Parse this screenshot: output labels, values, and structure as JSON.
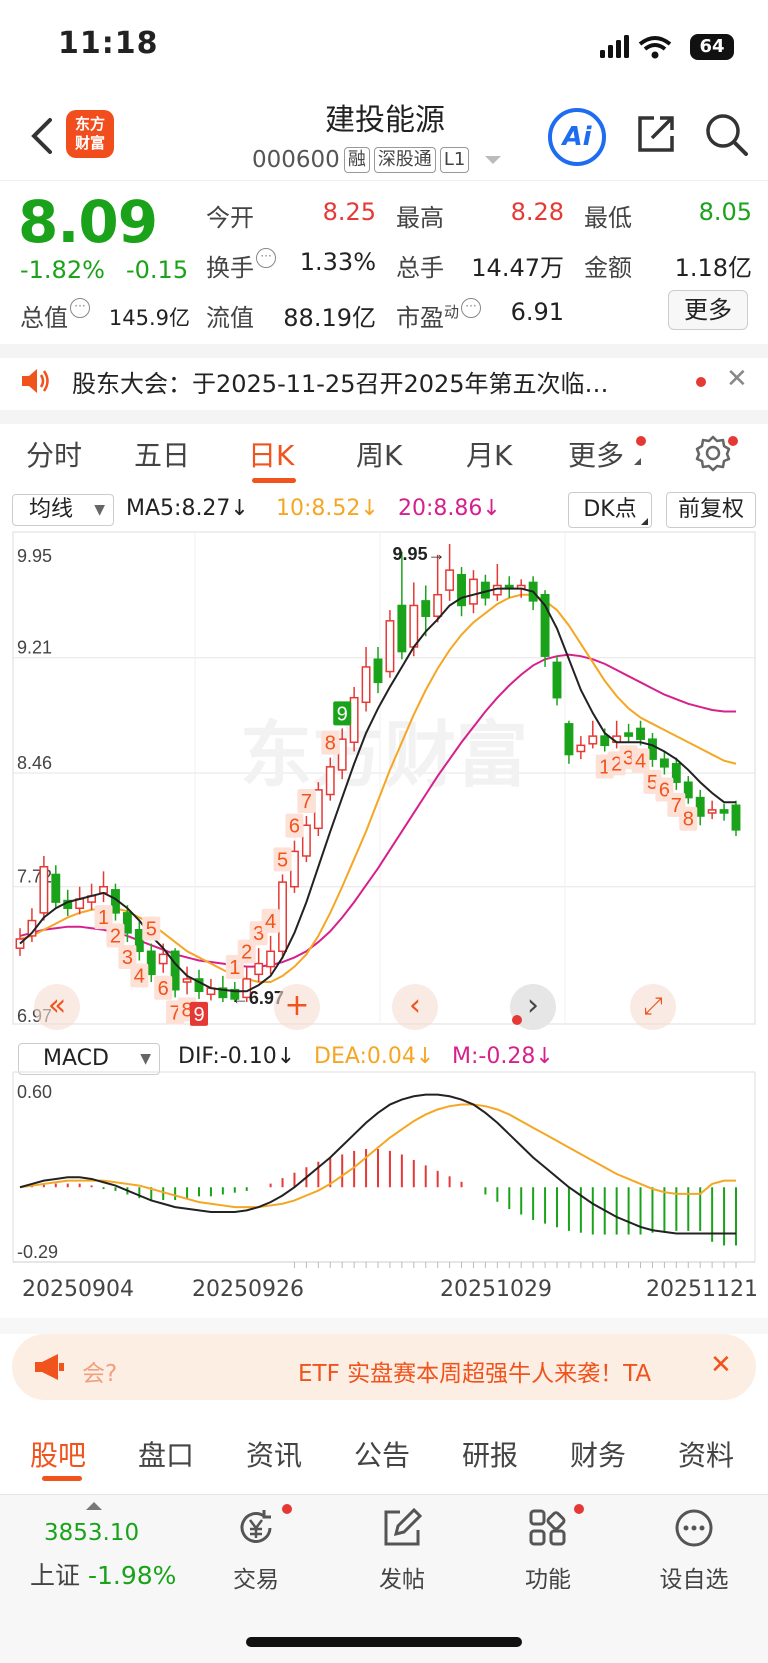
{
  "status": {
    "time": "11:18",
    "battery": "64"
  },
  "header": {
    "logo": "东方财富",
    "name": "建投能源",
    "code": "000600",
    "tags": [
      "融",
      "深股通",
      "L1"
    ],
    "ai": "Ai"
  },
  "quote": {
    "price": "8.09",
    "pct": "-1.82%",
    "change": "-0.15",
    "open_label": "今开",
    "open": "8.25",
    "high_label": "最高",
    "high": "8.28",
    "low_label": "最低",
    "low": "8.05",
    "turnover_label": "换手",
    "turnover": "1.33%",
    "volume_label": "总手",
    "volume": "14.47万",
    "amount_label": "金额",
    "amount": "1.18亿",
    "mcap_label": "总值",
    "mcap": "145.9亿",
    "float_label": "流值",
    "float": "88.19亿",
    "pe_label": "市盈",
    "pe_sup": "动",
    "pe": "6.91",
    "more": "更多"
  },
  "notice": {
    "text": "股东大会：于2025-11-25召开2025年第五次临…"
  },
  "period_tabs": [
    "分时",
    "五日",
    "日K",
    "周K",
    "月K",
    "更多"
  ],
  "ma_bar": {
    "select": "均线",
    "ma5": "MA5:8.27↓",
    "ma10": "10:8.52↓",
    "ma20": "20:8.86↓",
    "dk": "DK点",
    "adjust": "前复权"
  },
  "colors": {
    "up": "#e53935",
    "down": "#1aa31a",
    "accent": "#f0531c",
    "ma5": "#222222",
    "ma10": "#f5a623",
    "ma20": "#d6208c"
  },
  "chart_data": [
    {
      "type": "candlestick",
      "title": "日K",
      "y_ticks": [
        "9.95",
        "9.21",
        "8.46",
        "7.72",
        "6.97"
      ],
      "ylim": [
        6.97,
        9.95
      ],
      "annotations": {
        "high": "9.95",
        "low": "6.97"
      },
      "candles": [
        {
          "o": 7.32,
          "c": 7.38,
          "h": 7.45,
          "l": 7.27
        },
        {
          "o": 7.4,
          "c": 7.5,
          "h": 7.58,
          "l": 7.36
        },
        {
          "o": 7.55,
          "c": 7.85,
          "h": 7.92,
          "l": 7.5
        },
        {
          "o": 7.8,
          "c": 7.62,
          "h": 7.86,
          "l": 7.58
        },
        {
          "o": 7.63,
          "c": 7.58,
          "h": 7.7,
          "l": 7.53
        },
        {
          "o": 7.58,
          "c": 7.64,
          "h": 7.72,
          "l": 7.54
        },
        {
          "o": 7.62,
          "c": 7.66,
          "h": 7.74,
          "l": 7.57
        },
        {
          "o": 7.68,
          "c": 7.72,
          "h": 7.82,
          "l": 7.62
        },
        {
          "o": 7.7,
          "c": 7.55,
          "h": 7.74,
          "l": 7.5
        },
        {
          "o": 7.55,
          "c": 7.42,
          "h": 7.6,
          "l": 7.36
        },
        {
          "o": 7.44,
          "c": 7.3,
          "h": 7.5,
          "l": 7.24
        },
        {
          "o": 7.3,
          "c": 7.15,
          "h": 7.35,
          "l": 7.1
        },
        {
          "o": 7.22,
          "c": 7.28,
          "h": 7.35,
          "l": 7.16
        },
        {
          "o": 7.3,
          "c": 7.05,
          "h": 7.32,
          "l": 7.0
        },
        {
          "o": 7.1,
          "c": 7.12,
          "h": 7.2,
          "l": 7.02
        },
        {
          "o": 7.12,
          "c": 7.04,
          "h": 7.18,
          "l": 6.99
        },
        {
          "o": 7.02,
          "c": 7.06,
          "h": 7.12,
          "l": 6.98
        },
        {
          "o": 7.06,
          "c": 7.0,
          "h": 7.14,
          "l": 6.97
        },
        {
          "o": 7.05,
          "c": 6.99,
          "h": 7.1,
          "l": 6.97
        },
        {
          "o": 7.0,
          "c": 7.12,
          "h": 7.2,
          "l": 6.97
        },
        {
          "o": 7.15,
          "c": 7.22,
          "h": 7.32,
          "l": 7.1
        },
        {
          "o": 7.2,
          "c": 7.3,
          "h": 7.4,
          "l": 7.15
        },
        {
          "o": 7.3,
          "c": 7.75,
          "h": 7.8,
          "l": 7.25
        },
        {
          "o": 7.72,
          "c": 7.95,
          "h": 8.02,
          "l": 7.68
        },
        {
          "o": 7.92,
          "c": 8.12,
          "h": 8.18,
          "l": 7.88
        },
        {
          "o": 8.1,
          "c": 8.35,
          "h": 8.4,
          "l": 8.05
        },
        {
          "o": 8.32,
          "c": 8.5,
          "h": 8.56,
          "l": 8.28
        },
        {
          "o": 8.48,
          "c": 8.68,
          "h": 8.75,
          "l": 8.42
        },
        {
          "o": 8.66,
          "c": 8.95,
          "h": 9.02,
          "l": 8.6
        },
        {
          "o": 8.92,
          "c": 9.15,
          "h": 9.28,
          "l": 8.86
        },
        {
          "o": 9.2,
          "c": 9.05,
          "h": 9.28,
          "l": 8.98
        },
        {
          "o": 9.12,
          "c": 9.45,
          "h": 9.52,
          "l": 9.08
        },
        {
          "o": 9.55,
          "c": 9.25,
          "h": 9.9,
          "l": 9.2
        },
        {
          "o": 9.28,
          "c": 9.55,
          "h": 9.7,
          "l": 9.22
        },
        {
          "o": 9.58,
          "c": 9.48,
          "h": 9.68,
          "l": 9.35
        },
        {
          "o": 9.48,
          "c": 9.62,
          "h": 9.88,
          "l": 9.44
        },
        {
          "o": 9.65,
          "c": 9.78,
          "h": 9.95,
          "l": 9.58
        },
        {
          "o": 9.75,
          "c": 9.55,
          "h": 9.8,
          "l": 9.48
        },
        {
          "o": 9.56,
          "c": 9.72,
          "h": 9.78,
          "l": 9.5
        },
        {
          "o": 9.7,
          "c": 9.6,
          "h": 9.75,
          "l": 9.55
        },
        {
          "o": 9.62,
          "c": 9.68,
          "h": 9.82,
          "l": 9.58
        },
        {
          "o": 9.68,
          "c": 9.66,
          "h": 9.74,
          "l": 9.6
        },
        {
          "o": 9.66,
          "c": 9.68,
          "h": 9.72,
          "l": 9.6
        },
        {
          "o": 9.7,
          "c": 9.58,
          "h": 9.74,
          "l": 9.52
        },
        {
          "o": 9.62,
          "c": 9.22,
          "h": 9.65,
          "l": 9.15
        },
        {
          "o": 9.18,
          "c": 8.95,
          "h": 9.22,
          "l": 8.9
        },
        {
          "o": 8.78,
          "c": 8.58,
          "h": 8.8,
          "l": 8.52
        },
        {
          "o": 8.6,
          "c": 8.64,
          "h": 8.7,
          "l": 8.55
        },
        {
          "o": 8.65,
          "c": 8.7,
          "h": 8.8,
          "l": 8.62
        },
        {
          "o": 8.7,
          "c": 8.64,
          "h": 8.75,
          "l": 8.6
        },
        {
          "o": 8.66,
          "c": 8.7,
          "h": 8.8,
          "l": 8.62
        },
        {
          "o": 8.72,
          "c": 8.7,
          "h": 8.78,
          "l": 8.66
        },
        {
          "o": 8.75,
          "c": 8.68,
          "h": 8.8,
          "l": 8.64
        },
        {
          "o": 8.68,
          "c": 8.55,
          "h": 8.72,
          "l": 8.5
        },
        {
          "o": 8.55,
          "c": 8.5,
          "h": 8.6,
          "l": 8.45
        },
        {
          "o": 8.52,
          "c": 8.4,
          "h": 8.56,
          "l": 8.35
        },
        {
          "o": 8.4,
          "c": 8.3,
          "h": 8.44,
          "l": 8.26
        },
        {
          "o": 8.3,
          "c": 8.18,
          "h": 8.35,
          "l": 8.12
        },
        {
          "o": 8.2,
          "c": 8.22,
          "h": 8.28,
          "l": 8.16
        },
        {
          "o": 8.22,
          "c": 8.2,
          "h": 8.26,
          "l": 8.15
        },
        {
          "o": 8.25,
          "c": 8.09,
          "h": 8.28,
          "l": 8.05
        }
      ],
      "ma5": [
        7.35,
        7.42,
        7.52,
        7.58,
        7.62,
        7.64,
        7.66,
        7.68,
        7.64,
        7.58,
        7.5,
        7.4,
        7.32,
        7.22,
        7.14,
        7.1,
        7.06,
        7.05,
        7.04,
        7.04,
        7.08,
        7.14,
        7.26,
        7.42,
        7.62,
        7.85,
        8.08,
        8.3,
        8.52,
        8.72,
        8.88,
        9.02,
        9.15,
        9.28,
        9.38,
        9.46,
        9.55,
        9.6,
        9.62,
        9.64,
        9.66,
        9.66,
        9.66,
        9.64,
        9.55,
        9.4,
        9.2,
        9.0,
        8.85,
        8.72,
        8.66,
        8.66,
        8.66,
        8.64,
        8.6,
        8.55,
        8.48,
        8.4,
        8.33,
        8.27,
        8.27
      ],
      "ma10": [
        7.38,
        7.4,
        7.44,
        7.48,
        7.52,
        7.55,
        7.57,
        7.58,
        7.58,
        7.56,
        7.52,
        7.48,
        7.42,
        7.36,
        7.3,
        7.26,
        7.22,
        7.18,
        7.14,
        7.12,
        7.1,
        7.1,
        7.14,
        7.2,
        7.28,
        7.4,
        7.55,
        7.72,
        7.9,
        8.08,
        8.28,
        8.48,
        8.66,
        8.84,
        9.0,
        9.14,
        9.26,
        9.36,
        9.44,
        9.5,
        9.56,
        9.6,
        9.62,
        9.62,
        9.58,
        9.52,
        9.42,
        9.3,
        9.18,
        9.06,
        8.96,
        8.88,
        8.82,
        8.78,
        8.74,
        8.7,
        8.66,
        8.62,
        8.58,
        8.54,
        8.52
      ],
      "ma20": [
        7.4,
        7.42,
        7.44,
        7.45,
        7.46,
        7.46,
        7.45,
        7.44,
        7.42,
        7.4,
        7.37,
        7.34,
        7.31,
        7.28,
        7.26,
        7.24,
        7.23,
        7.22,
        7.21,
        7.2,
        7.2,
        7.21,
        7.23,
        7.26,
        7.3,
        7.36,
        7.43,
        7.52,
        7.62,
        7.73,
        7.84,
        7.96,
        8.08,
        8.2,
        8.32,
        8.44,
        8.55,
        8.66,
        8.76,
        8.86,
        8.95,
        9.03,
        9.1,
        9.16,
        9.2,
        9.22,
        9.23,
        9.22,
        9.2,
        9.17,
        9.13,
        9.09,
        9.05,
        9.01,
        8.97,
        8.94,
        8.91,
        8.89,
        8.87,
        8.86,
        8.86
      ],
      "signals": [
        {
          "i": 7,
          "t": "1",
          "pos": "below"
        },
        {
          "i": 8,
          "t": "2",
          "pos": "below"
        },
        {
          "i": 9,
          "t": "3",
          "pos": "below"
        },
        {
          "i": 10,
          "t": "4",
          "pos": "below"
        },
        {
          "i": 11,
          "t": "5",
          "pos": "above"
        },
        {
          "i": 12,
          "t": "6",
          "pos": "below"
        },
        {
          "i": 13,
          "t": "7",
          "pos": "below"
        },
        {
          "i": 14,
          "t": "8",
          "pos": "below"
        },
        {
          "i": 15,
          "t": "9",
          "pos": "below",
          "boxed": true
        },
        {
          "i": 18,
          "t": "1",
          "pos": "above"
        },
        {
          "i": 19,
          "t": "2",
          "pos": "above"
        },
        {
          "i": 20,
          "t": "3",
          "pos": "above"
        },
        {
          "i": 21,
          "t": "4",
          "pos": "above"
        },
        {
          "i": 22,
          "t": "5",
          "pos": "above"
        },
        {
          "i": 23,
          "t": "6",
          "pos": "above"
        },
        {
          "i": 24,
          "t": "7",
          "pos": "above"
        },
        {
          "i": 26,
          "t": "8",
          "pos": "above"
        },
        {
          "i": 27,
          "t": "9",
          "pos": "above",
          "boxed": true,
          "green": true
        },
        {
          "i": 49,
          "t": "1",
          "pos": "below"
        },
        {
          "i": 50,
          "t": "2",
          "pos": "below"
        },
        {
          "i": 51,
          "t": "3",
          "pos": "below"
        },
        {
          "i": 52,
          "t": "4",
          "pos": "below"
        },
        {
          "i": 53,
          "t": "5",
          "pos": "below"
        },
        {
          "i": 54,
          "t": "6",
          "pos": "below"
        },
        {
          "i": 55,
          "t": "7",
          "pos": "below"
        },
        {
          "i": 56,
          "t": "8",
          "pos": "below"
        }
      ]
    },
    {
      "type": "macd",
      "y_ticks": [
        "0.60",
        "-0.29"
      ],
      "ylim": [
        -0.29,
        0.6
      ],
      "x_ticks": [
        "20250904",
        "20250926",
        "20251029",
        "20251121"
      ],
      "dif": [
        0.0,
        0.02,
        0.04,
        0.05,
        0.06,
        0.06,
        0.05,
        0.03,
        0.01,
        -0.02,
        -0.05,
        -0.08,
        -0.1,
        -0.12,
        -0.13,
        -0.14,
        -0.15,
        -0.15,
        -0.15,
        -0.14,
        -0.12,
        -0.09,
        -0.05,
        0.0,
        0.06,
        0.12,
        0.18,
        0.25,
        0.32,
        0.39,
        0.45,
        0.5,
        0.53,
        0.55,
        0.56,
        0.56,
        0.55,
        0.53,
        0.5,
        0.45,
        0.39,
        0.32,
        0.25,
        0.18,
        0.12,
        0.06,
        0.0,
        -0.05,
        -0.1,
        -0.14,
        -0.18,
        -0.21,
        -0.24,
        -0.26,
        -0.27,
        -0.28,
        -0.28,
        -0.28,
        -0.28,
        -0.28,
        -0.28
      ],
      "dea": [
        0.0,
        0.01,
        0.02,
        0.03,
        0.04,
        0.04,
        0.04,
        0.04,
        0.03,
        0.02,
        0.01,
        -0.01,
        -0.03,
        -0.05,
        -0.07,
        -0.09,
        -0.1,
        -0.11,
        -0.12,
        -0.12,
        -0.12,
        -0.11,
        -0.1,
        -0.08,
        -0.05,
        -0.02,
        0.02,
        0.07,
        0.12,
        0.18,
        0.24,
        0.3,
        0.35,
        0.4,
        0.44,
        0.47,
        0.49,
        0.5,
        0.5,
        0.49,
        0.47,
        0.44,
        0.4,
        0.36,
        0.32,
        0.28,
        0.24,
        0.2,
        0.16,
        0.12,
        0.08,
        0.05,
        0.02,
        -0.01,
        -0.03,
        -0.04,
        -0.04,
        -0.04,
        0.02,
        0.04,
        0.04
      ],
      "m": [
        0.0,
        0.02,
        0.04,
        0.04,
        0.04,
        0.04,
        0.02,
        -0.02,
        -0.04,
        -0.08,
        -0.12,
        -0.14,
        -0.14,
        -0.14,
        -0.12,
        -0.1,
        -0.1,
        -0.08,
        -0.06,
        -0.04,
        0.0,
        0.04,
        0.1,
        0.16,
        0.22,
        0.28,
        0.32,
        0.36,
        0.4,
        0.42,
        0.42,
        0.4,
        0.36,
        0.3,
        0.24,
        0.18,
        0.12,
        0.06,
        0.0,
        -0.08,
        -0.16,
        -0.24,
        -0.3,
        -0.36,
        -0.4,
        -0.44,
        -0.48,
        -0.5,
        -0.52,
        -0.52,
        -0.52,
        -0.52,
        -0.52,
        -0.5,
        -0.48,
        -0.48,
        -0.48,
        -0.48,
        -0.6,
        -0.64,
        -0.64
      ]
    }
  ],
  "macd_bar": {
    "select": "MACD",
    "dif": "DIF:-0.10↓",
    "dea": "DEA:0.04↓",
    "m": "M:-0.28↓"
  },
  "low_label": "←6.97",
  "high_label": "9.95→",
  "watermark": "东方财富",
  "promo": {
    "text": "ETF 实盘赛本周超强牛人来袭！TA",
    "q": "会?"
  },
  "bottom_tabs": [
    "股吧",
    "盘口",
    "资讯",
    "公告",
    "研报",
    "财务",
    "资料"
  ],
  "dock": {
    "index_value": "3853.10",
    "index_label": "上证",
    "index_pct": "-1.98%",
    "items": [
      "交易",
      "发帖",
      "功能",
      "设自选"
    ]
  }
}
